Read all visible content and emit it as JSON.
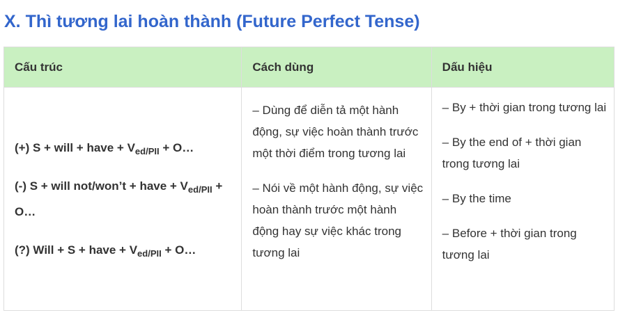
{
  "heading": "X. Thì tương lai hoàn thành (Future Perfect Tense)",
  "table": {
    "headers": [
      "Cấu trúc",
      "Cách dùng",
      "Dấu hiệu"
    ],
    "structure": [
      {
        "before": "(+) S + will + have + V",
        "sub": "ed/PII",
        "after": " + O…"
      },
      {
        "before": "(-) S + will not/won’t + have + V",
        "sub": "ed/PII",
        "after": " + O…"
      },
      {
        "before": "(?) Will + S + have + V",
        "sub": "ed/PII",
        "after": " + O…"
      }
    ],
    "usage": [
      "– Dùng để diễn tả một hành động, sự việc hoàn thành trước một thời điểm trong tương lai",
      "– Nói về một hành động, sự việc hoàn thành trước một hành động hay sự việc khác trong tương lai"
    ],
    "signs": [
      "– By + thời gian trong tương lai",
      "– By the end of + thời gian trong tương lai",
      "– By the time",
      "– Before + thời gian trong tương lai"
    ]
  }
}
